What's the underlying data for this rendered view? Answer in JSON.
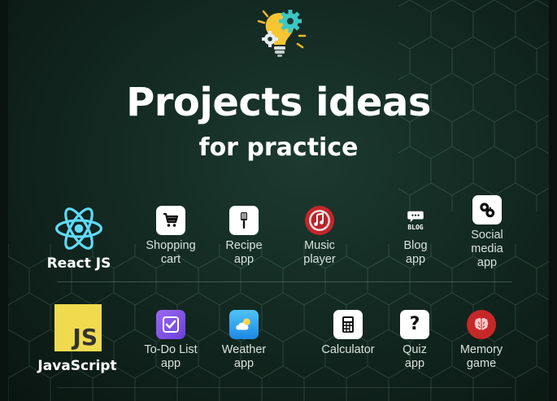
{
  "header": {
    "title": "Projects ideas",
    "subtitle": "for practice"
  },
  "icons": {
    "hero": "lightbulb-gears-icon"
  },
  "colors": {
    "react": "#61dafb",
    "javascript": "#f0db4f",
    "background": "#132a22"
  },
  "sections": [
    {
      "tech": "React JS",
      "tech_icon": "react-logo-icon",
      "items": [
        {
          "label": "Shopping\ncart",
          "icon": "shopping-cart-icon"
        },
        {
          "label": "Recipe\napp",
          "icon": "spatula-icon"
        },
        {
          "label": "Music\nplayer",
          "icon": "music-note-icon"
        },
        {
          "label": "Blog\napp",
          "icon": "blog-chat-icon",
          "icon_text": "BLOG"
        },
        {
          "label": "Social\nmedia\napp",
          "icon": "social-media-icon"
        }
      ]
    },
    {
      "tech": "JavaScript",
      "tech_icon": "js-logo-icon",
      "tech_icon_text": "JS",
      "items": [
        {
          "label": "To-Do List\napp",
          "icon": "checkbox-icon"
        },
        {
          "label": "Weather\napp",
          "icon": "weather-cloud-icon"
        },
        {
          "label": "Calculator",
          "icon": "calculator-icon"
        },
        {
          "label": "Quiz\napp",
          "icon": "question-mark-icon",
          "icon_text": "?"
        },
        {
          "label": "Memory\ngame",
          "icon": "brain-icon"
        }
      ]
    }
  ]
}
